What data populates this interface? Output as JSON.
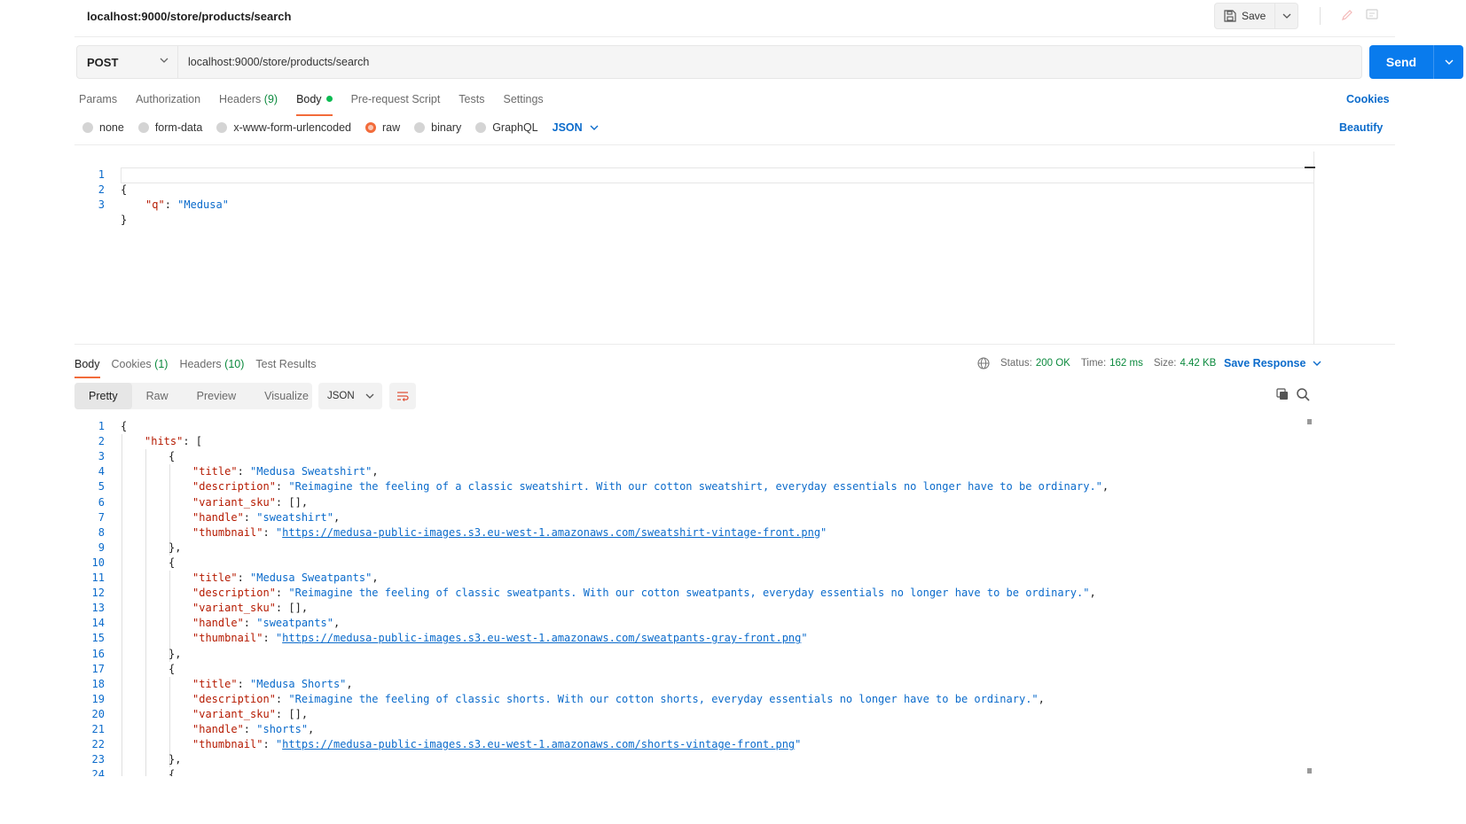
{
  "request": {
    "title": "localhost:9000/store/products/search",
    "save_label": "Save",
    "method": "POST",
    "url": "localhost:9000/store/products/search",
    "send_label": "Send",
    "tabs": [
      {
        "label": "Params",
        "count": ""
      },
      {
        "label": "Authorization",
        "count": ""
      },
      {
        "label": "Headers",
        "count": "(9)"
      },
      {
        "label": "Body",
        "count": ""
      },
      {
        "label": "Pre-request Script",
        "count": ""
      },
      {
        "label": "Tests",
        "count": ""
      },
      {
        "label": "Settings",
        "count": ""
      }
    ],
    "active_tab": "Body",
    "cookies_label": "Cookies",
    "body_types": [
      "none",
      "form-data",
      "x-www-form-urlencoded",
      "raw",
      "binary",
      "GraphQL"
    ],
    "selected_body_type": "raw",
    "body_format": "JSON",
    "beautify_label": "Beautify",
    "body_lines": [
      {
        "n": "1",
        "text": "{"
      },
      {
        "n": "2",
        "key": "\"q\"",
        "value": "\"Medusa\""
      },
      {
        "n": "3",
        "text": "}"
      }
    ]
  },
  "response": {
    "tabs": [
      {
        "label": "Body",
        "count": ""
      },
      {
        "label": "Cookies",
        "count": "(1)"
      },
      {
        "label": "Headers",
        "count": "(10)"
      },
      {
        "label": "Test Results",
        "count": ""
      }
    ],
    "active_tab": "Body",
    "status_label": "Status:",
    "status_value": "200 OK",
    "time_label": "Time:",
    "time_value": "162 ms",
    "size_label": "Size:",
    "size_value": "4.42 KB",
    "save_response_label": "Save Response",
    "views": [
      "Pretty",
      "Raw",
      "Preview",
      "Visualize"
    ],
    "active_view": "Pretty",
    "format": "JSON",
    "lines": [
      {
        "n": "1",
        "indent": 0,
        "text": "{"
      },
      {
        "n": "2",
        "indent": 1,
        "key": "\"hits\"",
        "text": ": ["
      },
      {
        "n": "3",
        "indent": 2,
        "text": "{"
      },
      {
        "n": "4",
        "indent": 3,
        "key": "\"title\"",
        "value": "\"Medusa Sweatshirt\"",
        "tail": ","
      },
      {
        "n": "5",
        "indent": 3,
        "key": "\"description\"",
        "value": "\"Reimagine the feeling of a classic sweatshirt. With our cotton sweatshirt, everyday essentials no longer have to be ordinary.\"",
        "tail": ","
      },
      {
        "n": "6",
        "indent": 3,
        "key": "\"variant_sku\"",
        "text": ": [],"
      },
      {
        "n": "7",
        "indent": 3,
        "key": "\"handle\"",
        "value": "\"sweatshirt\"",
        "tail": ","
      },
      {
        "n": "8",
        "indent": 3,
        "key": "\"thumbnail\"",
        "link": "https://medusa-public-images.s3.eu-west-1.amazonaws.com/sweatshirt-vintage-front.png"
      },
      {
        "n": "9",
        "indent": 2,
        "text": "},"
      },
      {
        "n": "10",
        "indent": 2,
        "text": "{"
      },
      {
        "n": "11",
        "indent": 3,
        "key": "\"title\"",
        "value": "\"Medusa Sweatpants\"",
        "tail": ","
      },
      {
        "n": "12",
        "indent": 3,
        "key": "\"description\"",
        "value": "\"Reimagine the feeling of classic sweatpants. With our cotton sweatpants, everyday essentials no longer have to be ordinary.\"",
        "tail": ","
      },
      {
        "n": "13",
        "indent": 3,
        "key": "\"variant_sku\"",
        "text": ": [],"
      },
      {
        "n": "14",
        "indent": 3,
        "key": "\"handle\"",
        "value": "\"sweatpants\"",
        "tail": ","
      },
      {
        "n": "15",
        "indent": 3,
        "key": "\"thumbnail\"",
        "link": "https://medusa-public-images.s3.eu-west-1.amazonaws.com/sweatpants-gray-front.png"
      },
      {
        "n": "16",
        "indent": 2,
        "text": "},"
      },
      {
        "n": "17",
        "indent": 2,
        "text": "{"
      },
      {
        "n": "18",
        "indent": 3,
        "key": "\"title\"",
        "value": "\"Medusa Shorts\"",
        "tail": ","
      },
      {
        "n": "19",
        "indent": 3,
        "key": "\"description\"",
        "value": "\"Reimagine the feeling of classic shorts. With our cotton shorts, everyday essentials no longer have to be ordinary.\"",
        "tail": ","
      },
      {
        "n": "20",
        "indent": 3,
        "key": "\"variant_sku\"",
        "text": ": [],"
      },
      {
        "n": "21",
        "indent": 3,
        "key": "\"handle\"",
        "value": "\"shorts\"",
        "tail": ","
      },
      {
        "n": "22",
        "indent": 3,
        "key": "\"thumbnail\"",
        "link": "https://medusa-public-images.s3.eu-west-1.amazonaws.com/shorts-vintage-front.png"
      },
      {
        "n": "23",
        "indent": 2,
        "text": "},"
      },
      {
        "n": "24",
        "indent": 2,
        "text": "{"
      }
    ]
  },
  "colors": {
    "accent": "#097bed",
    "tab_underline": "#f26b3a",
    "json_key": "#b51a00",
    "json_string": "#0b6bcb",
    "status_ok": "#0c8a3e"
  },
  "icons": [
    "save-icon",
    "chevron-down-icon",
    "edit-icon",
    "comment-icon",
    "globe-icon",
    "wrap-lines-icon",
    "copy-icon",
    "search-icon"
  ]
}
